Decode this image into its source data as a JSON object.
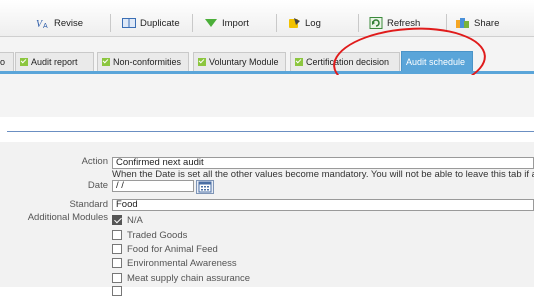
{
  "toolbar": {
    "revise": "Revise",
    "duplicate": "Duplicate",
    "import": "Import",
    "log": "Log",
    "refresh": "Refresh",
    "share": "Share"
  },
  "tabs": [
    {
      "label": "o",
      "checked": false,
      "active": false
    },
    {
      "label": "Audit report",
      "checked": true,
      "active": false
    },
    {
      "label": "Non-conformities",
      "checked": true,
      "active": false
    },
    {
      "label": "Voluntary Module",
      "checked": true,
      "active": false
    },
    {
      "label": "Certification decision",
      "checked": true,
      "active": false
    },
    {
      "label": "Audit schedule",
      "checked": false,
      "active": true
    }
  ],
  "form": {
    "action_label": "Action",
    "action_value": "Confirmed next audit",
    "date_hint": "When the Date is set all the other values become mandatory. You will not be able to leave this tab if a field",
    "date_label": "Date",
    "date_value": " / /",
    "standard_label": "Standard",
    "standard_value": "Food",
    "modules_label": "Additional Modules",
    "modules": [
      {
        "label": "N/A",
        "checked": true
      },
      {
        "label": "Traded Goods",
        "checked": false
      },
      {
        "label": "Food for Animal Feed",
        "checked": false
      },
      {
        "label": "Environmental Awareness",
        "checked": false
      },
      {
        "label": "Meat supply chain assurance",
        "checked": false
      }
    ]
  },
  "colors": {
    "active_tab": "#5aa5d9",
    "check_green": "#8cc63f",
    "annotation_red": "#e01b1b"
  }
}
